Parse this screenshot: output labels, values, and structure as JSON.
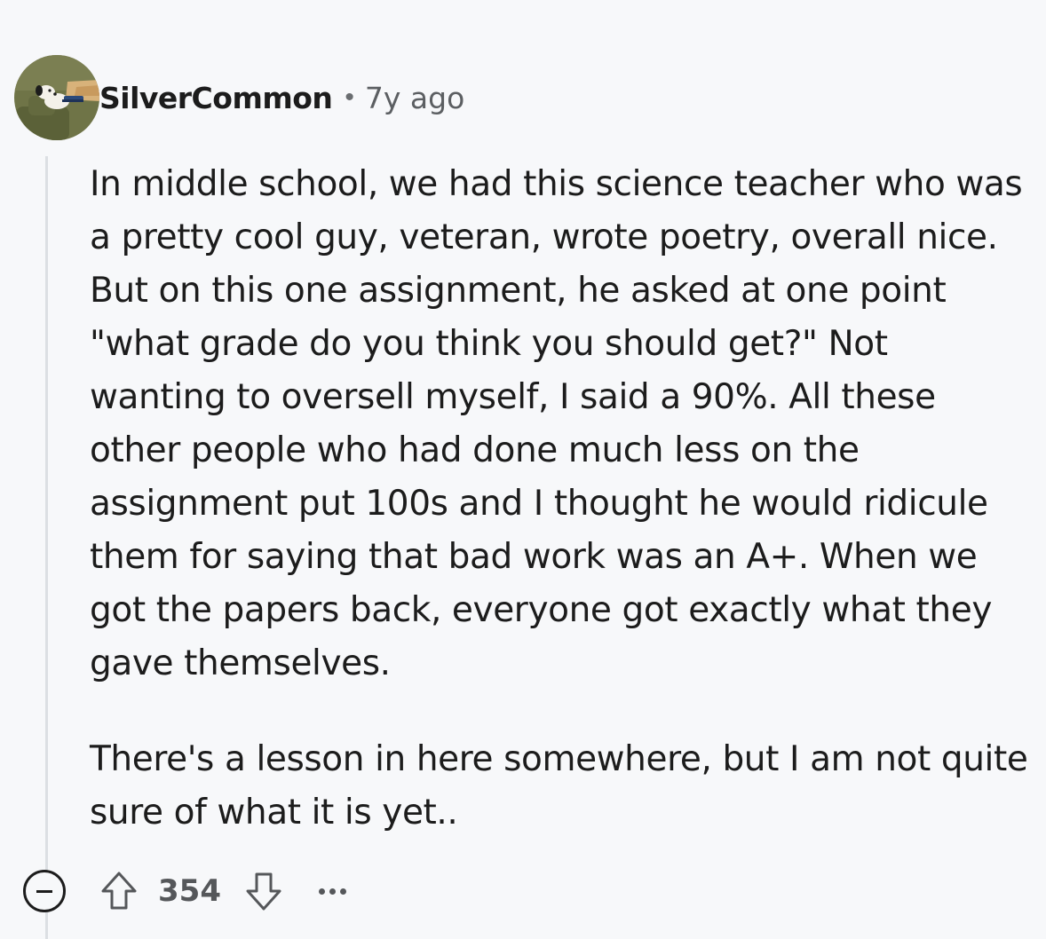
{
  "comment": {
    "author": "SilverCommon",
    "separator": "•",
    "age": "7y ago",
    "avatar_icon": "snoopy-avatar-icon",
    "paragraphs": [
      "In middle school, we had this science teacher who was a pretty cool guy, veteran, wrote poetry, overall nice. But on this one assignment, he asked at one point \"what grade do you think you should get?\" Not wanting to oversell myself, I said a 90%. All these other people who had done much less on the assignment put 100s and I thought he would ridicule them for saying that bad work was an A+. When we got the papers back, everyone got exactly what they gave themselves.",
      "There's a lesson in here somewhere, but I am not quite sure of what it is yet.."
    ],
    "score": "354"
  },
  "colors": {
    "background": "#f7f8fa",
    "text": "#1c1c1c",
    "muted": "#5c5f62",
    "thread_line": "#dcdfe3"
  }
}
